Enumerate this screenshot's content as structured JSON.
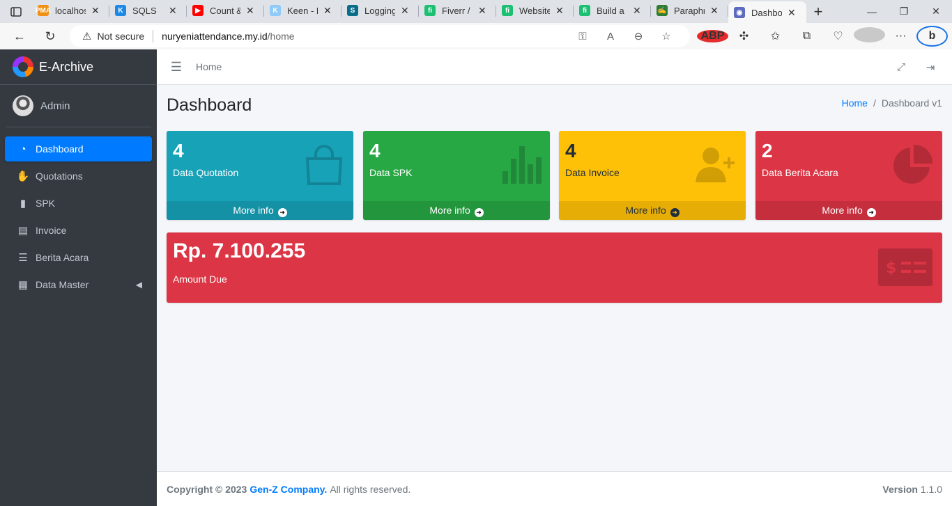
{
  "browser": {
    "tabs": [
      {
        "label": "localhost",
        "fav_color": "#f29111",
        "fav_text": "PMA"
      },
      {
        "label": "SQLS",
        "fav_color": "#1e88e5",
        "fav_text": "K"
      },
      {
        "label": "Count &",
        "fav_color": "#ff0000",
        "fav_text": "▶"
      },
      {
        "label": "Keen - M",
        "fav_color": "#90caf9",
        "fav_text": "K"
      },
      {
        "label": "Logging",
        "fav_color": "#0a6e8a",
        "fav_text": "S"
      },
      {
        "label": "Fiverr / g",
        "fav_color": "#1dbf73",
        "fav_text": "fi"
      },
      {
        "label": "Website",
        "fav_color": "#1dbf73",
        "fav_text": "fi"
      },
      {
        "label": "Build a p",
        "fav_color": "#1dbf73",
        "fav_text": "fi"
      },
      {
        "label": "Paraphra",
        "fav_color": "#2e7d32",
        "fav_text": "✍"
      },
      {
        "label": "Dashboa",
        "fav_color": "#5c6bc0",
        "fav_text": "◉",
        "active": true
      }
    ],
    "security_label": "Not secure",
    "url_host": "nuryeniattendance.my.id",
    "url_path": "/home",
    "abp_label": "ABP"
  },
  "sidebar": {
    "brand": "E-Archive",
    "user": "Admin",
    "items": [
      {
        "label": "Dashboard",
        "icon": "tachometer-icon",
        "glyph": "◔",
        "active": true
      },
      {
        "label": "Quotations",
        "icon": "hand-holding-icon",
        "glyph": "✋"
      },
      {
        "label": "SPK",
        "icon": "book-icon",
        "glyph": "▮"
      },
      {
        "label": "Invoice",
        "icon": "receipt-icon",
        "glyph": "▤"
      },
      {
        "label": "Berita Acara",
        "icon": "list-alt-icon",
        "glyph": "☰"
      },
      {
        "label": "Data Master",
        "icon": "table-icon",
        "glyph": "▦",
        "has_caret": true
      }
    ]
  },
  "header": {
    "home_link": "Home"
  },
  "content": {
    "title": "Dashboard",
    "breadcrumb_home": "Home",
    "breadcrumb_current": "Dashboard v1",
    "breadcrumb_separator": "/",
    "boxes": [
      {
        "count": "4",
        "label": "Data Quotation",
        "footer": "More info",
        "icon": "shopping-bag-icon"
      },
      {
        "count": "4",
        "label": "Data SPK",
        "footer": "More info",
        "icon": "bar-chart-icon"
      },
      {
        "count": "4",
        "label": "Data Invoice",
        "footer": "More info",
        "icon": "user-plus-icon"
      },
      {
        "count": "2",
        "label": "Data Berita Acara",
        "footer": "More info",
        "icon": "pie-chart-icon"
      }
    ],
    "amount_box": {
      "value": "Rp. 7.100.255",
      "label": "Amount Due",
      "icon": "money-bill-icon"
    }
  },
  "footer": {
    "copyright": "Copyright © 2023",
    "company": "Gen-Z Company.",
    "rights": "All rights reserved.",
    "version_label": "Version",
    "version_value": "1.1.0"
  },
  "colors": {
    "info": "#17a2b8",
    "success": "#28a745",
    "warning": "#ffc107",
    "danger": "#dc3545",
    "primary": "#007bff",
    "sidebar_bg": "#343a40"
  }
}
